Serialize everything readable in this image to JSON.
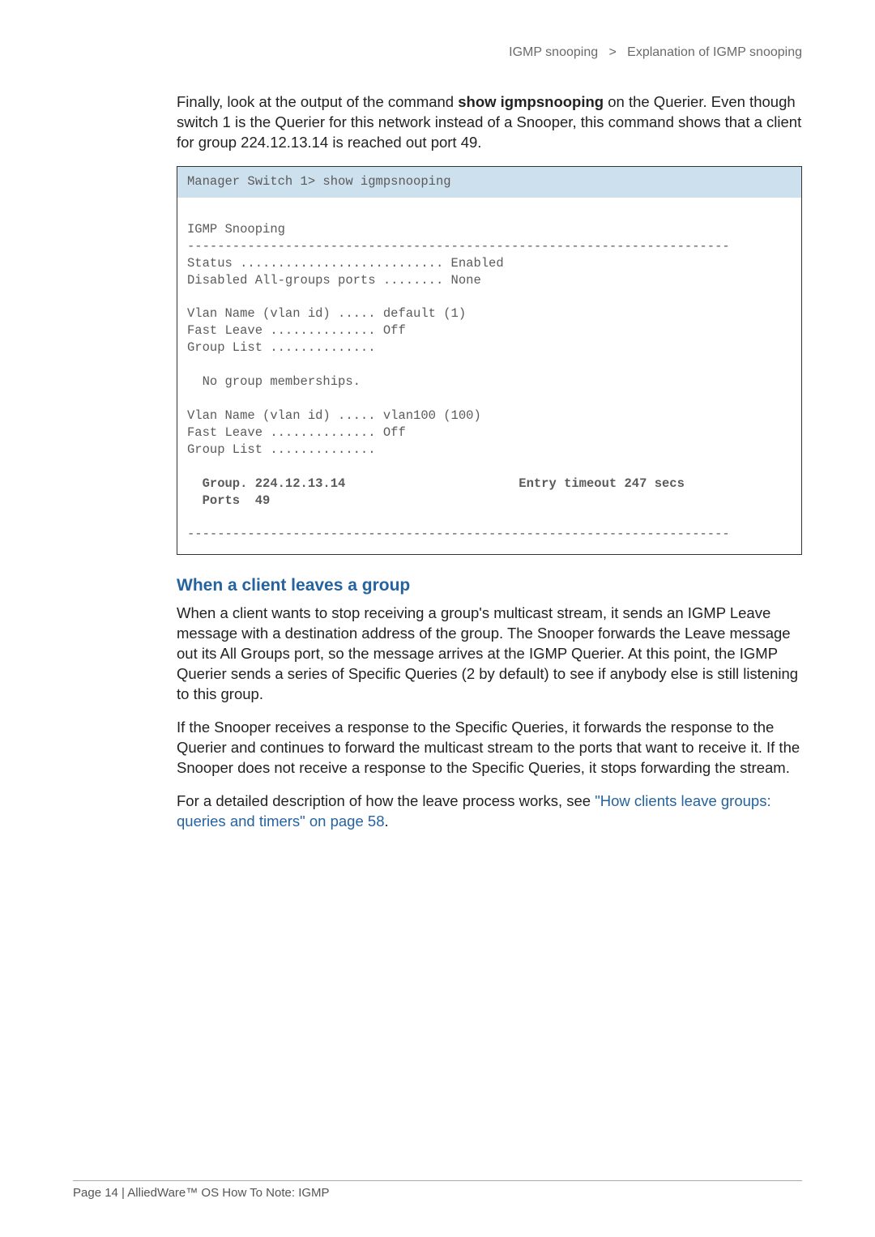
{
  "breadcrumb": {
    "left": "IGMP snooping",
    "sep": ">",
    "right": "Explanation of IGMP snooping"
  },
  "intro": {
    "pre": "Finally, look at the output of the command ",
    "cmd": "show igmpsnooping",
    "post": " on the Querier. Even though switch 1 is the Querier for this network instead of a Snooper, this command shows that a client for group 224.12.13.14 is reached out port 49."
  },
  "cli": {
    "command": "Manager Switch 1> show igmpsnooping",
    "output_plain_1": "\nIGMP Snooping\n------------------------------------------------------------------------\nStatus ........................... Enabled\nDisabled All-groups ports ........ None\n\nVlan Name (vlan id) ..... default (1)\nFast Leave .............. Off\nGroup List ..............\n\n  No group memberships.\n\nVlan Name (vlan id) ..... vlan100 (100)\nFast Leave .............. Off\nGroup List ..............\n",
    "output_bold": "\n  Group. 224.12.13.14                       Entry timeout 247 secs\n  Ports  49",
    "output_plain_2": "\n\n------------------------------------------------------------------------\n"
  },
  "section_heading": "When a client leaves a group",
  "para1": "When a client wants to stop receiving a group's multicast stream, it sends an IGMP Leave message with a destination address of the group. The Snooper forwards the Leave message out its All Groups port, so the message arrives at the IGMP Querier. At this point, the IGMP Querier sends a series of Specific Queries (2 by default) to see if anybody else is still listening to this group.",
  "para2": "If the Snooper receives a response to the Specific Queries, it forwards the response to the Querier and continues to forward the multicast stream to the ports that want to receive it. If the Snooper does not receive a response to the Specific Queries, it stops forwarding the stream.",
  "para3_pre": "For a detailed description of how the leave process works, see ",
  "para3_link": "\"How clients leave groups: queries and timers\" on page 58",
  "para3_post": ".",
  "footer": "Page 14 | AlliedWare™ OS How To Note: IGMP",
  "chart_data": {
    "type": "table",
    "title": "IGMP Snooping status",
    "rows": [
      {
        "field": "Status",
        "value": "Enabled"
      },
      {
        "field": "Disabled All-groups ports",
        "value": "None"
      },
      {
        "field": "Vlan Name (vlan id)",
        "value": "default (1)"
      },
      {
        "field": "Fast Leave",
        "value": "Off"
      },
      {
        "field": "Group List",
        "value": "No group memberships."
      },
      {
        "field": "Vlan Name (vlan id)",
        "value": "vlan100 (100)"
      },
      {
        "field": "Fast Leave",
        "value": "Off"
      },
      {
        "field": "Group",
        "value": "224.12.13.14"
      },
      {
        "field": "Entry timeout",
        "value": "247 secs"
      },
      {
        "field": "Ports",
        "value": "49"
      }
    ]
  }
}
